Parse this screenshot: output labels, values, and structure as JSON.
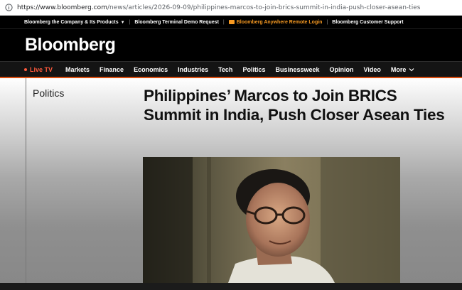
{
  "browser": {
    "url_host": "https://www.bloomberg.com",
    "url_path": "/news/articles/2026-09-09/philippines-marcos-to-join-brics-summit-in-india-push-closer-asean-ties"
  },
  "utility_bar": {
    "company": "Bloomberg the Company & Its Products",
    "terminal_demo": "Bloomberg Terminal Demo Request",
    "anywhere": "Bloomberg Anywhere Remote Login",
    "customer_support": "Bloomberg Customer Support"
  },
  "masthead": {
    "logo": "Bloomberg"
  },
  "nav": {
    "live": "Live TV",
    "items": [
      "Markets",
      "Finance",
      "Economics",
      "Industries",
      "Tech",
      "Politics",
      "Businessweek",
      "Opinion",
      "Video"
    ],
    "more": "More"
  },
  "article": {
    "section": "Politics",
    "headline": "Philippines’ Marcos to Join BRICS Summit in India, Push Closer Asean Ties"
  },
  "colors": {
    "accent_orange": "#f79a22",
    "live_red": "#ff5a3c",
    "nav_underline": "#d94d0f"
  }
}
